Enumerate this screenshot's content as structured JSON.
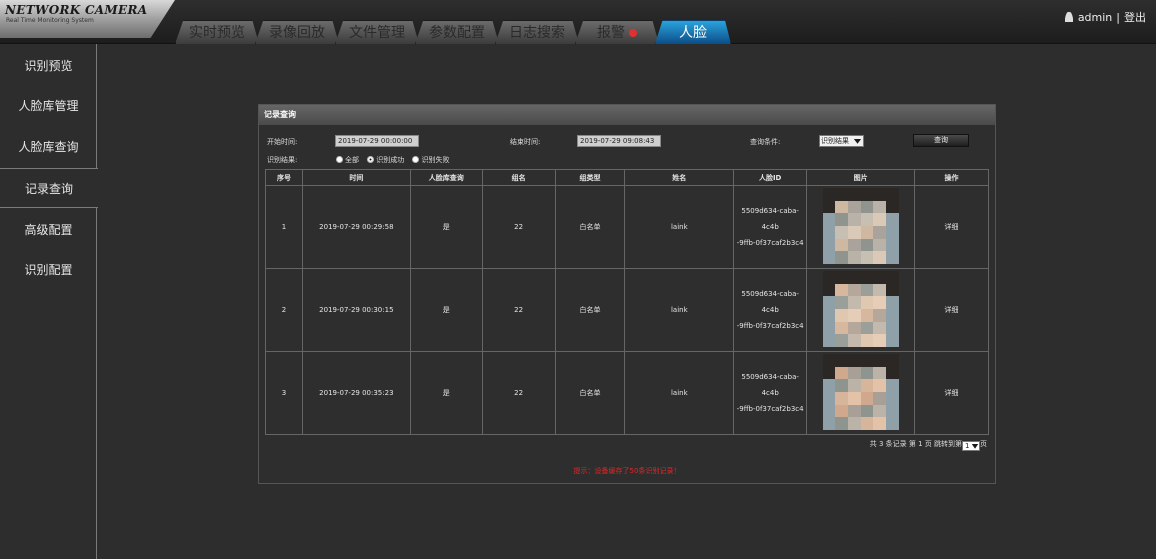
{
  "header": {
    "logo_title": "NETWORK CAMERA",
    "logo_subtitle": "Real Time Monitoring System",
    "tabs": [
      {
        "label": "实时预览",
        "active": false,
        "badge": false
      },
      {
        "label": "录像回放",
        "active": false,
        "badge": false
      },
      {
        "label": "文件管理",
        "active": false,
        "badge": false
      },
      {
        "label": "参数配置",
        "active": false,
        "badge": false
      },
      {
        "label": "日志搜索",
        "active": false,
        "badge": false
      },
      {
        "label": "报警",
        "active": false,
        "badge": true
      },
      {
        "label": "人脸",
        "active": true,
        "badge": false
      }
    ],
    "user": "admin",
    "separator": "|",
    "logout": "登出"
  },
  "sidebar": {
    "items": [
      {
        "label": "识别预览",
        "active": false
      },
      {
        "label": "人脸库管理",
        "active": false
      },
      {
        "label": "人脸库查询",
        "active": false
      },
      {
        "label": "记录查询",
        "active": true
      },
      {
        "label": "高级配置",
        "active": false
      },
      {
        "label": "识别配置",
        "active": false
      }
    ]
  },
  "panel": {
    "title": "记录查询",
    "filters": {
      "start_label": "开始时间:",
      "start_value": "2019-07-29 00:00:00",
      "end_label": "结束时间:",
      "end_value": "2019-07-29 09:08:43",
      "condition_label": "查询条件:",
      "condition_value": "识别结果",
      "query_button": "查询",
      "result_label": "识别结果:",
      "radios": [
        {
          "label": "全部",
          "checked": false
        },
        {
          "label": "识别成功",
          "checked": true
        },
        {
          "label": "识别失败",
          "checked": false
        }
      ]
    },
    "table": {
      "columns": [
        "序号",
        "时间",
        "人脸库查询",
        "组名",
        "组类型",
        "姓名",
        "人脸ID",
        "图片",
        "操作"
      ],
      "rows": [
        {
          "index": "1",
          "time": "2019-07-29 00:29:58",
          "library": "是",
          "group": "22",
          "group_type": "白名单",
          "name": "laink",
          "face_id_1": "5509d634-caba-4c4b",
          "face_id_2": "-9ffb-0f37caf2b3c4",
          "action": "详细"
        },
        {
          "index": "2",
          "time": "2019-07-29 00:30:15",
          "library": "是",
          "group": "22",
          "group_type": "白名单",
          "name": "laink",
          "face_id_1": "5509d634-caba-4c4b",
          "face_id_2": "-9ffb-0f37caf2b3c4",
          "action": "详细"
        },
        {
          "index": "3",
          "time": "2019-07-29 00:35:23",
          "library": "是",
          "group": "22",
          "group_type": "白名单",
          "name": "laink",
          "face_id_1": "5509d634-caba-4c4b",
          "face_id_2": "-9ffb-0f37caf2b3c4",
          "action": "详细"
        }
      ]
    },
    "pager": {
      "text_total": "共 3 条记录",
      "text_page": "第 1 页",
      "text_jump": "跳转到第",
      "page_value": "1",
      "text_suffix": "页"
    },
    "note": "提示：设备缓存了50条识别记录！"
  },
  "colors": {
    "background": "#2d2d2d",
    "active_tab": "#1f86c4",
    "note": "#e02828"
  }
}
